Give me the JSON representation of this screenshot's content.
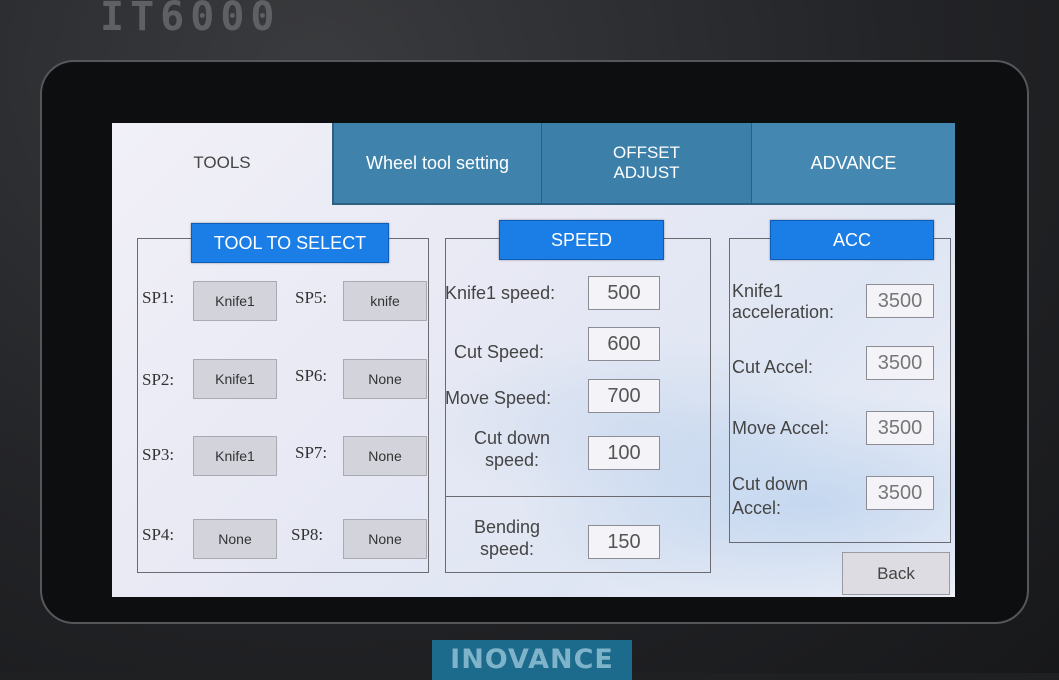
{
  "device": {
    "model": "IT6000",
    "brand": "INOVANCE"
  },
  "tabs": [
    {
      "label": "TOOLS"
    },
    {
      "label": "Wheel tool setting"
    },
    {
      "label_line1": "OFFSET",
      "label_line2": "ADJUST"
    },
    {
      "label": "ADVANCE"
    }
  ],
  "tool_select": {
    "title": "TOOL TO SELECT",
    "slots": [
      {
        "label": "SP1:",
        "value": "Knife1"
      },
      {
        "label": "SP2:",
        "value": "Knife1"
      },
      {
        "label": "SP3:",
        "value": "Knife1"
      },
      {
        "label": "SP4:",
        "value": "None"
      },
      {
        "label": "SP5:",
        "value": "knife"
      },
      {
        "label": "SP6:",
        "value": "None"
      },
      {
        "label": "SP7:",
        "value": "None"
      },
      {
        "label": "SP8:",
        "value": "None"
      }
    ]
  },
  "speed": {
    "title": "SPEED",
    "fields": [
      {
        "label": "Knife1 speed:",
        "value": "500"
      },
      {
        "label": "Cut Speed:",
        "value": "600"
      },
      {
        "label": "Move Speed:",
        "value": "700"
      },
      {
        "label_line1": "Cut down",
        "label_line2": "speed:",
        "value": "100"
      }
    ],
    "bending": {
      "label_line1": "Bending",
      "label_line2": "speed:",
      "value": "150"
    }
  },
  "acc": {
    "title": "ACC",
    "fields": [
      {
        "label_line1": "Knife1",
        "label_line2": "acceleration:",
        "value": "3500"
      },
      {
        "label": "Cut Accel:",
        "value": "3500"
      },
      {
        "label": "Move Accel:",
        "value": "3500"
      },
      {
        "label_line1": "Cut down",
        "label_line2": "Accel:",
        "value": "3500"
      }
    ]
  },
  "back_button": "Back"
}
